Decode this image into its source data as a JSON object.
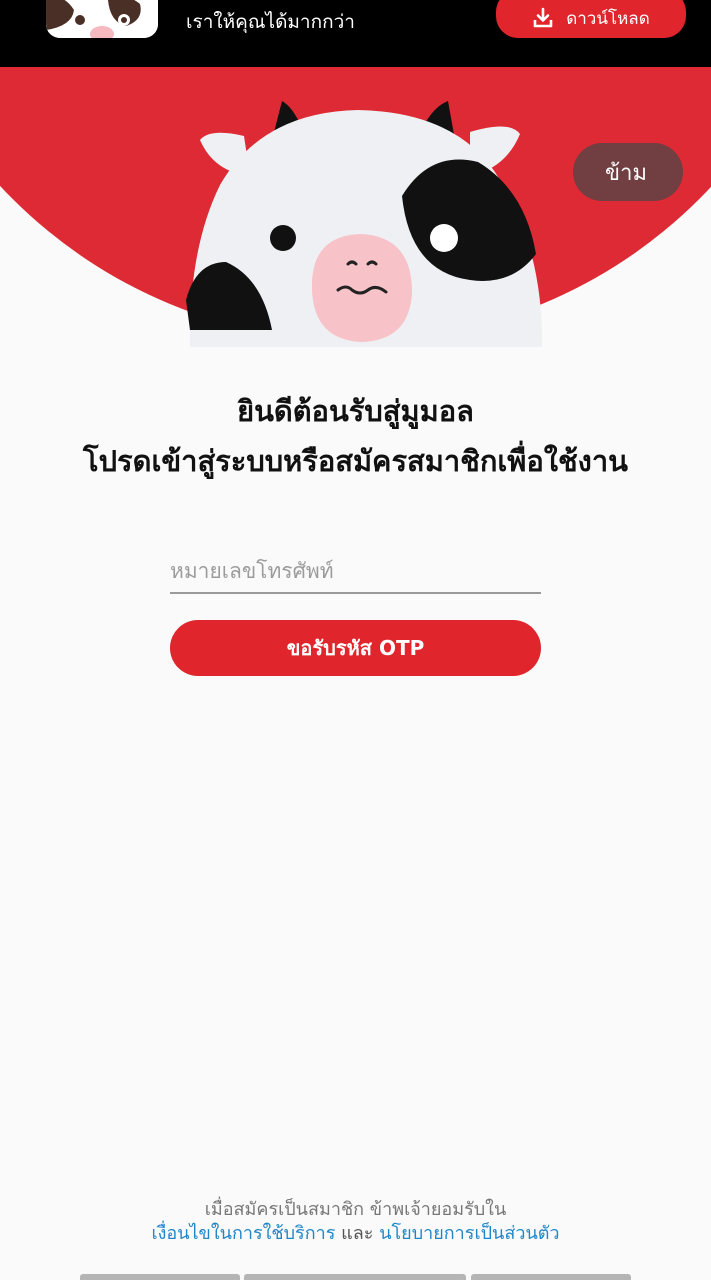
{
  "banner": {
    "tagline": "เราให้คุณได้มากกว่า",
    "download_label": "ดาวน์โหลด",
    "download_icon": "download-icon"
  },
  "hero": {
    "skip_label": "ข้าม",
    "mascot": "cow-mascot",
    "background_color": "#de2a34"
  },
  "welcome": {
    "line1": "ยินดีต้อนรับสู่มูมอล",
    "line2": "โปรดเข้าสู่ระบบหรือสมัครสมาชิกเพื่อใช้งาน"
  },
  "form": {
    "phone_value": "",
    "phone_placeholder": "หมายเลขโทรศัพท์",
    "otp_button_label": "ขอรับรหัส OTP"
  },
  "terms": {
    "prefix": "เมื่อสมัครเป็นสมาชิก ข้าพเจ้ายอมรับใน",
    "terms_link": "เงื่อนไขในการใช้บริการ",
    "and": "และ",
    "privacy_link": "นโยบายการเป็นส่วนตัว"
  },
  "colors": {
    "accent": "#e0252c",
    "link": "#1f86c8"
  }
}
